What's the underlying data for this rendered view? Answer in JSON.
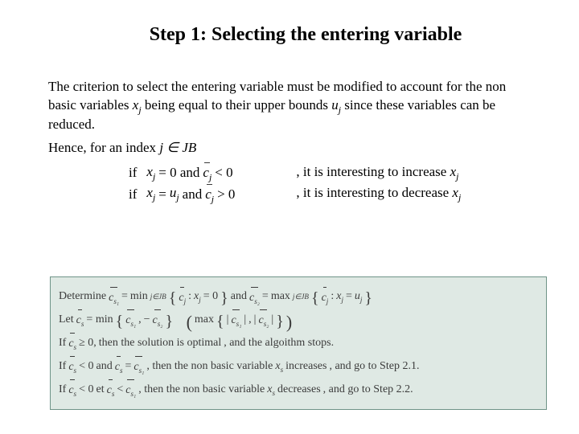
{
  "title": "Step 1: Selecting the entering variable",
  "p1_a": "The criterion to select the entering variable must be modified to account for the non basic variables ",
  "p1_xj": "x",
  "p1_b": " being equal to their upper bounds ",
  "p1_uj": "u",
  "p1_c": " since these variables can be reduced.",
  "p2_a": "Hence, for an index  ",
  "p2_j": "j ∈ JB",
  "if": "if",
  "cond1_a": "x",
  "cond1_eq": " = 0  and  ",
  "cond1_cj": "c",
  "cond1_lt": " < 0",
  "then1_a": ", it is interesting to increase ",
  "then1_xj": "x",
  "cond2_a": "x",
  "cond2_eq": " = ",
  "cond2_uj": "u",
  "cond2_and": "  and  ",
  "cond2_cj": "c",
  "cond2_gt": " > 0",
  "then2_a": ", it is interesting to decrease ",
  "then2_xj": "x",
  "j": "j",
  "box": {
    "determine": "Determine ",
    "cs1": "c",
    "s1": "s₁",
    "eq": " = ",
    "min": "min",
    "jJB": "j∈JB",
    "set_open": "{",
    "set_close": "}",
    "cj": "c",
    "colon": " : ",
    "xj_eq0": " = 0",
    "and": " and ",
    "cs2": "c",
    "s2": "s₂",
    "max": "max",
    "xj_eq_uj": " = ",
    "uj": "u",
    "let": "Let ",
    "cs": "c",
    "s": "s",
    "minrow": " = min",
    "comma": ", ",
    "neg": "−",
    "open_p": "(",
    "close_p": ")",
    "maxrow": "max",
    "abs": "|",
    "if": "If ",
    "ge0": " ≥ 0, ",
    "optimal": "then the solution is optimal",
    "stops": ", and the algoithm stops.",
    "lt0": " < 0  ",
    "and2": "and  ",
    "eq_cs1": " = ",
    "then_inc": ", then the non basic variable ",
    "xs": "x",
    "increases": " increases",
    "goto21": ", and go to Step 2.1.",
    "et": "et  ",
    "lt_cs1": " < ",
    "decreases": " decreases",
    "goto22": ", and go to Step 2.2."
  }
}
